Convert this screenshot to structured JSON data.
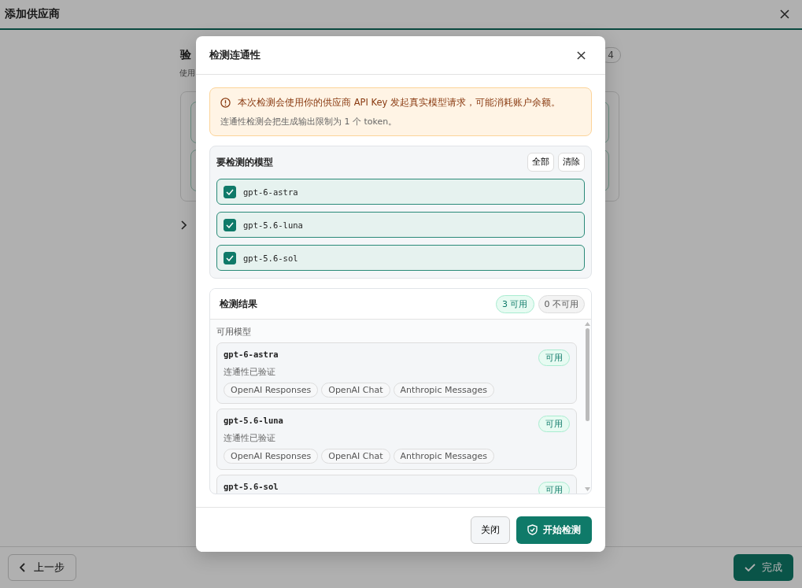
{
  "page": {
    "title": "添加供应商",
    "step_title": "验",
    "step_desc": "使用",
    "step_badge": "4",
    "back_button": "上一步",
    "finish_button": "完成"
  },
  "dialog": {
    "title": "检测连通性",
    "warning": {
      "text": "本次检测会使用你的供应商 API Key 发起真实模型请求，可能消耗账户余额。",
      "note": "连通性检测会把生成输出限制为 1 个 token。"
    },
    "models": {
      "title": "要检测的模型",
      "all_button": "全部",
      "clear_button": "清除",
      "items": [
        {
          "name": "gpt-6-astra",
          "checked": true
        },
        {
          "name": "gpt-5.6-luna",
          "checked": true
        },
        {
          "name": "gpt-5.6-sol",
          "checked": true
        }
      ]
    },
    "results": {
      "title": "检测结果",
      "available_count": "3 可用",
      "unavailable_count": "0 不可用",
      "group_label": "可用模型",
      "items": [
        {
          "name": "gpt-6-astra",
          "status": "可用",
          "detail": "连通性已验证",
          "tags": [
            "OpenAI Responses",
            "OpenAI Chat",
            "Anthropic Messages"
          ]
        },
        {
          "name": "gpt-5.6-luna",
          "status": "可用",
          "detail": "连通性已验证",
          "tags": [
            "OpenAI Responses",
            "OpenAI Chat",
            "Anthropic Messages"
          ]
        },
        {
          "name": "gpt-5.6-sol",
          "status": "可用"
        }
      ]
    },
    "close_button": "关闭",
    "start_button": "开始检测"
  }
}
